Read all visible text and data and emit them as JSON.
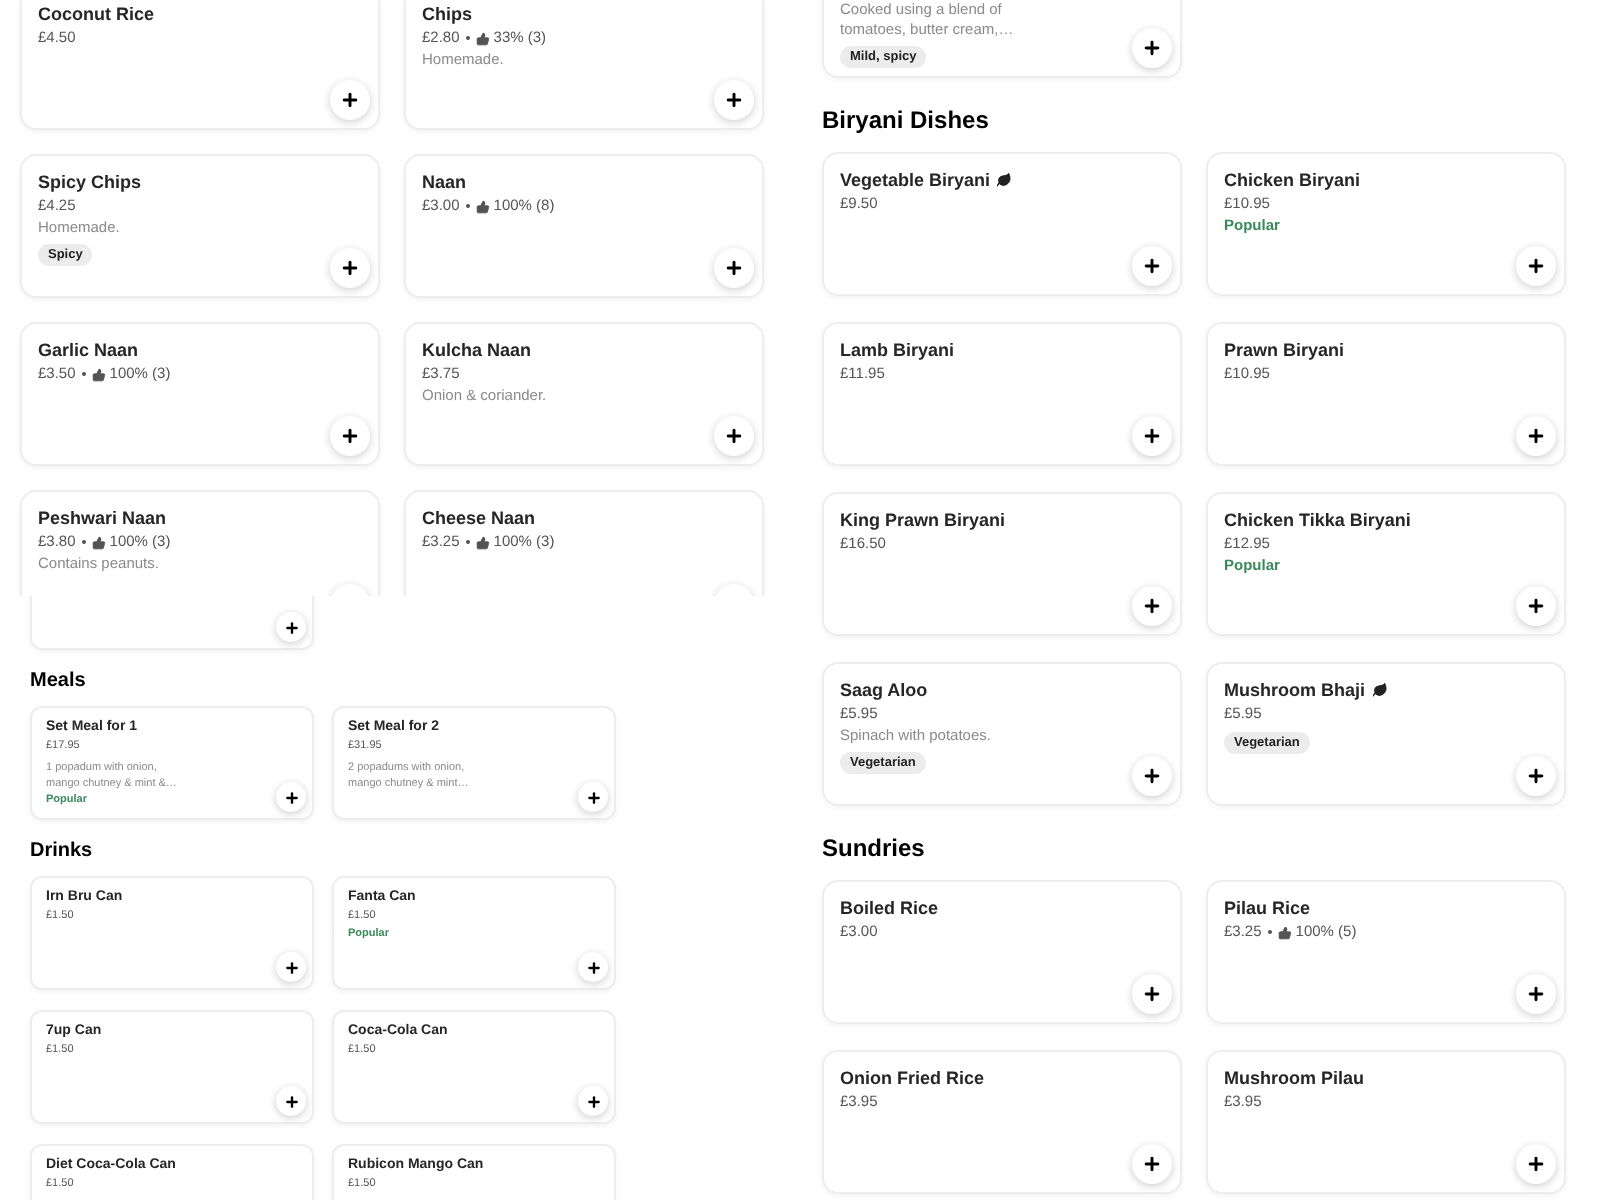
{
  "view_1": {
    "items": [
      {
        "name": "Coconut Rice",
        "price": "£4.50"
      },
      {
        "name": "Chips",
        "price": "£2.80",
        "rating": "33% (3)",
        "description": "Homemade."
      },
      {
        "name": "Spicy Chips",
        "price": "£4.25",
        "description": "Homemade.",
        "tags": [
          "Spicy"
        ]
      },
      {
        "name": "Naan",
        "price": "£3.00",
        "rating": "100% (8)"
      },
      {
        "name": "Garlic Naan",
        "price": "£3.50",
        "rating": "100% (3)"
      },
      {
        "name": "Kulcha Naan",
        "price": "£3.75",
        "description": "Onion & coriander."
      },
      {
        "name": "Peshwari Naan",
        "price": "£3.80",
        "rating": "100% (3)",
        "description": "Contains peanuts."
      },
      {
        "name": "Cheese Naan",
        "price": "£3.25",
        "rating": "100% (3)"
      }
    ]
  },
  "view_2": {
    "partial_card_above": true,
    "sections": [
      {
        "heading": "Meals",
        "items": [
          {
            "name": "Set Meal for 1",
            "price": "£17.95",
            "description": "1 popadum with onion, mango chutney & mint &…",
            "popular": "Popular"
          },
          {
            "name": "Set Meal for 2",
            "price": "£31.95",
            "description": "2 popadums with onion, mango chutney & mint…"
          }
        ]
      },
      {
        "heading": "Drinks",
        "items": [
          {
            "name": "Irn Bru Can",
            "price": "£1.50"
          },
          {
            "name": "Fanta Can",
            "price": "£1.50",
            "popular": "Popular"
          },
          {
            "name": "7up Can",
            "price": "£1.50"
          },
          {
            "name": "Coca-Cola Can",
            "price": "£1.50"
          },
          {
            "name": "Diet Coca-Cola Can",
            "price": "£1.50"
          },
          {
            "name": "Rubicon Mango Can",
            "price": "£1.50"
          }
        ]
      }
    ]
  },
  "view_3": {
    "partial_item_above": {
      "description": "Cooked using a blend of tomatoes, butter cream,…",
      "tags": [
        "Mild, spicy"
      ]
    },
    "sections": [
      {
        "heading": "Biryani Dishes",
        "items": [
          {
            "name": "Vegetable Biryani",
            "plant_based": true,
            "price": "£9.50"
          },
          {
            "name": "Chicken Biryani",
            "plant_based": false,
            "price": "£10.95",
            "popular": "Popular"
          },
          {
            "name": "Lamb Biryani",
            "plant_based": false,
            "price": "£11.95"
          },
          {
            "name": "Prawn Biryani",
            "plant_based": false,
            "price": "£10.95"
          },
          {
            "name": "King Prawn Biryani",
            "plant_based": false,
            "price": "£16.50"
          },
          {
            "name": "Chicken Tikka Biryani",
            "plant_based": false,
            "price": "£12.95",
            "popular": "Popular"
          },
          {
            "name": "Saag Aloo",
            "plant_based": false,
            "price": "£5.95",
            "description": "Spinach with potatoes.",
            "tags": [
              "Vegetarian"
            ]
          },
          {
            "name": "Mushroom Bhaji",
            "plant_based": true,
            "price": "£5.95",
            "tags": [
              "Vegetarian"
            ]
          }
        ]
      },
      {
        "heading": "Sundries",
        "items": [
          {
            "name": "Boiled Rice",
            "price": "£3.00"
          },
          {
            "name": "Pilau Rice",
            "price": "£3.25",
            "rating": "100% (5)"
          },
          {
            "name": "Onion Fried Rice",
            "price": "£3.95"
          },
          {
            "name": "Mushroom Pilau",
            "price": "£3.95"
          }
        ]
      }
    ]
  }
}
